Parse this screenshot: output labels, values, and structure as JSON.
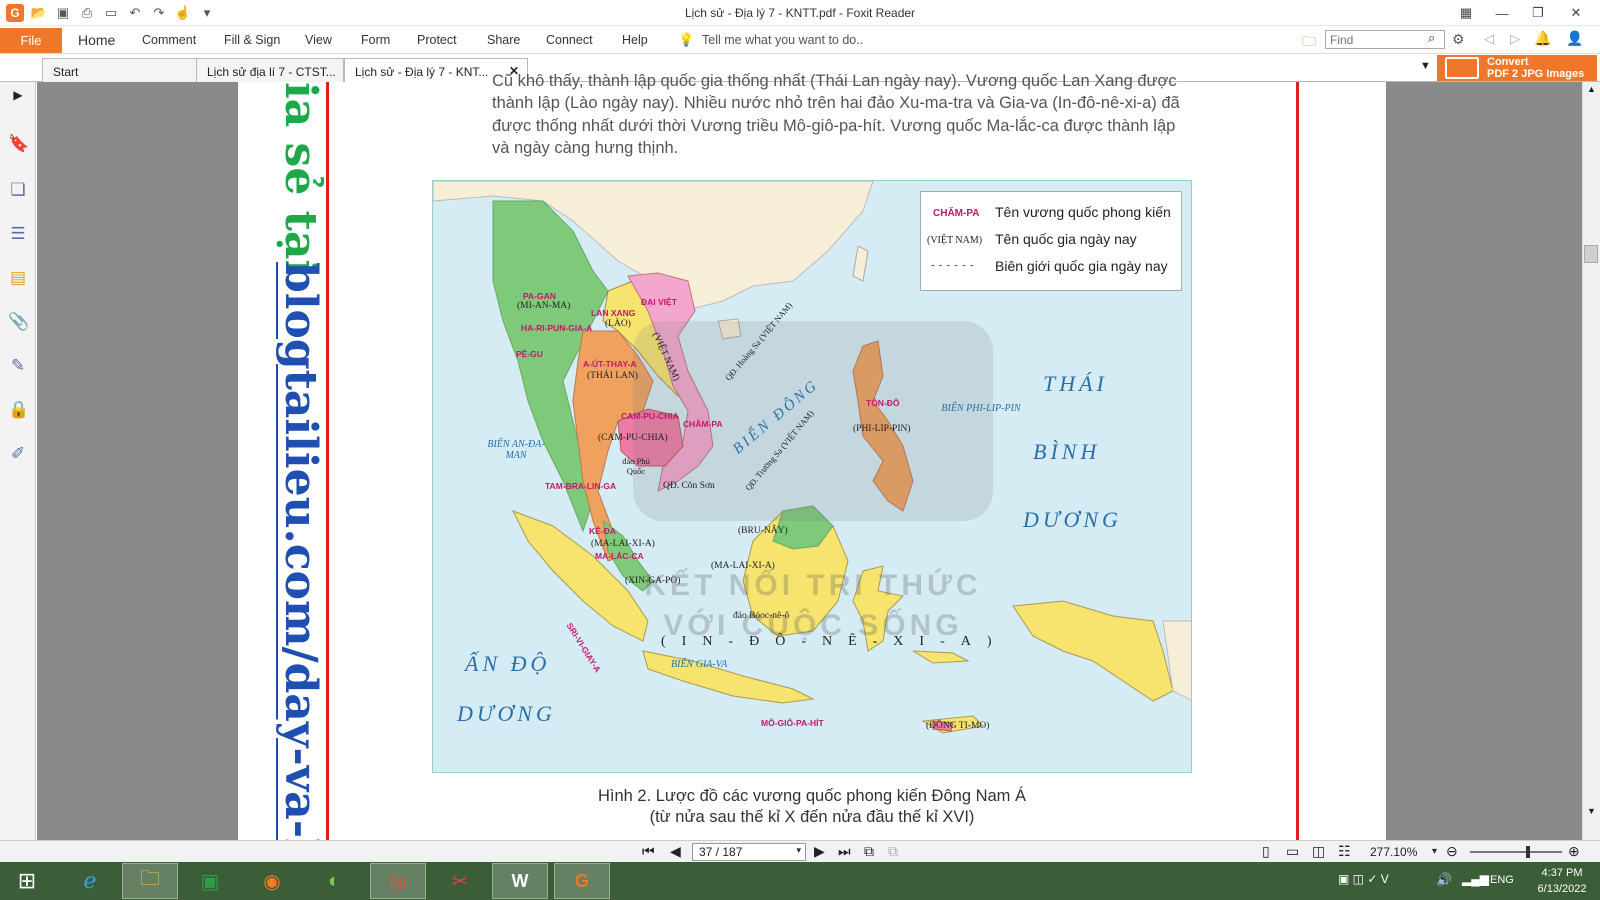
{
  "window": {
    "title": "Lịch sử - Địa lý 7 - KNTT.pdf - Foxit Reader"
  },
  "menu": {
    "file": "File",
    "items": [
      "Home",
      "Comment",
      "Fill & Sign",
      "View",
      "Form",
      "Protect",
      "Share",
      "Connect",
      "Help"
    ],
    "tell_me": "Tell me what you want to do..",
    "find_placeholder": "Find"
  },
  "tabs": [
    {
      "label": "Start"
    },
    {
      "label": "Lịch sử địa lí 7 - CTST..."
    },
    {
      "label": "Lịch sử - Địa lý 7 - KNT..."
    }
  ],
  "convert": {
    "line1": "Convert",
    "line2": "PDF 2 JPG Images"
  },
  "document": {
    "watermark_green": "ia sẻ tại",
    "watermark_blue": "blogtailieu.com/day-va-ho",
    "paragraph_lines": [
      "Cũ khô thấy, thành lập quốc gia thống nhất (Thái Lan ngày nay). Vương quốc Lan Xang được",
      "thành lập (Lào ngày nay). Nhiều nước nhỏ trên hai đảo Xu-ma-tra và Gia-va (In-đô-nê-xi-a) đã",
      "được thống nhất dưới thời Vương triều Mô-giô-pa-hít. Vương quốc Ma-lắc-ca được thành lập",
      "và ngày càng hưng thịnh."
    ],
    "caption_line1": "Hình 2. Lược đồ các vương quốc phong kiến Đông Nam Á",
    "caption_line2": "(từ nửa sau thế kỉ X đến nửa đầu thế kỉ XVI)"
  },
  "map": {
    "legend": [
      {
        "key": "CHĂM-PA",
        "text": "Tên vương quốc phong kiến",
        "color": "#c2186b"
      },
      {
        "key": "(VIỆT NAM)",
        "text": "Tên quốc gia ngày nay",
        "color": "#222222"
      },
      {
        "key": "- - - - - -",
        "text": "Biên giới quốc gia ngày nay",
        "color": "#555555"
      }
    ],
    "kingdoms": [
      "PA-GAN",
      "HA-RI-PUN-GIA-A",
      "PÊ-GU",
      "LAN XANG",
      "ĐẠI VIỆT",
      "A-ÚT-THAY-A",
      "CAM-PU-CHIA",
      "CHĂM-PA",
      "TAM-BRA-LIN-GA",
      "KÊ-ĐA",
      "MA-LẮC-CA",
      "SRI-VI-GIAY-A",
      "TÔN-ĐÔ",
      "MÔ-GIÔ-PA-HÍT"
    ],
    "countries": [
      "(MI-AN-MA)",
      "(LÀO)",
      "(THÁI LAN)",
      "(VIỆT NAM)",
      "(CAM-PU-CHIA)",
      "(MA-LAI-XI-A)",
      "(XIN-GA-PO)",
      "(BRU-NÂY)",
      "(MA-LAI-XI-A)",
      "(PHI-LIP-PIN)",
      "(IN-ĐÔ-NÊ-XI-A)",
      "(ĐÔNG TI-MO)"
    ],
    "seas": [
      "BIỂN AN-ĐA-MAN",
      "BIỂN ĐÔNG",
      "BIỂN PHI-LIP-PIN",
      "BIỂN GIA-VA"
    ],
    "places": [
      "QĐ. Hoàng Sa (VIỆT NAM)",
      "QĐ. Trường Sa (VIỆT NAM)",
      "đảo Phú Quốc",
      "QĐ. Côn Sơn",
      "đảo Bóoc-nê-ô"
    ],
    "oceans": [
      "THÁI",
      "BÌNH",
      "DƯƠNG",
      "ẤN ĐỘ",
      "DƯƠNG"
    ],
    "watermark": "KẾT NỐI TRI THỨC VỚI CUỘC SỐNG"
  },
  "statusbar": {
    "page_value": "37 / 187",
    "zoom": "277.10%"
  },
  "taskbar": {
    "language": "ENG",
    "time": "4:37 PM",
    "date": "6/13/2022",
    "apps": [
      "internet-explorer",
      "file-explorer",
      "store",
      "firefox",
      "coccoc",
      "chrome",
      "ccleaner",
      "word",
      "foxit"
    ]
  }
}
